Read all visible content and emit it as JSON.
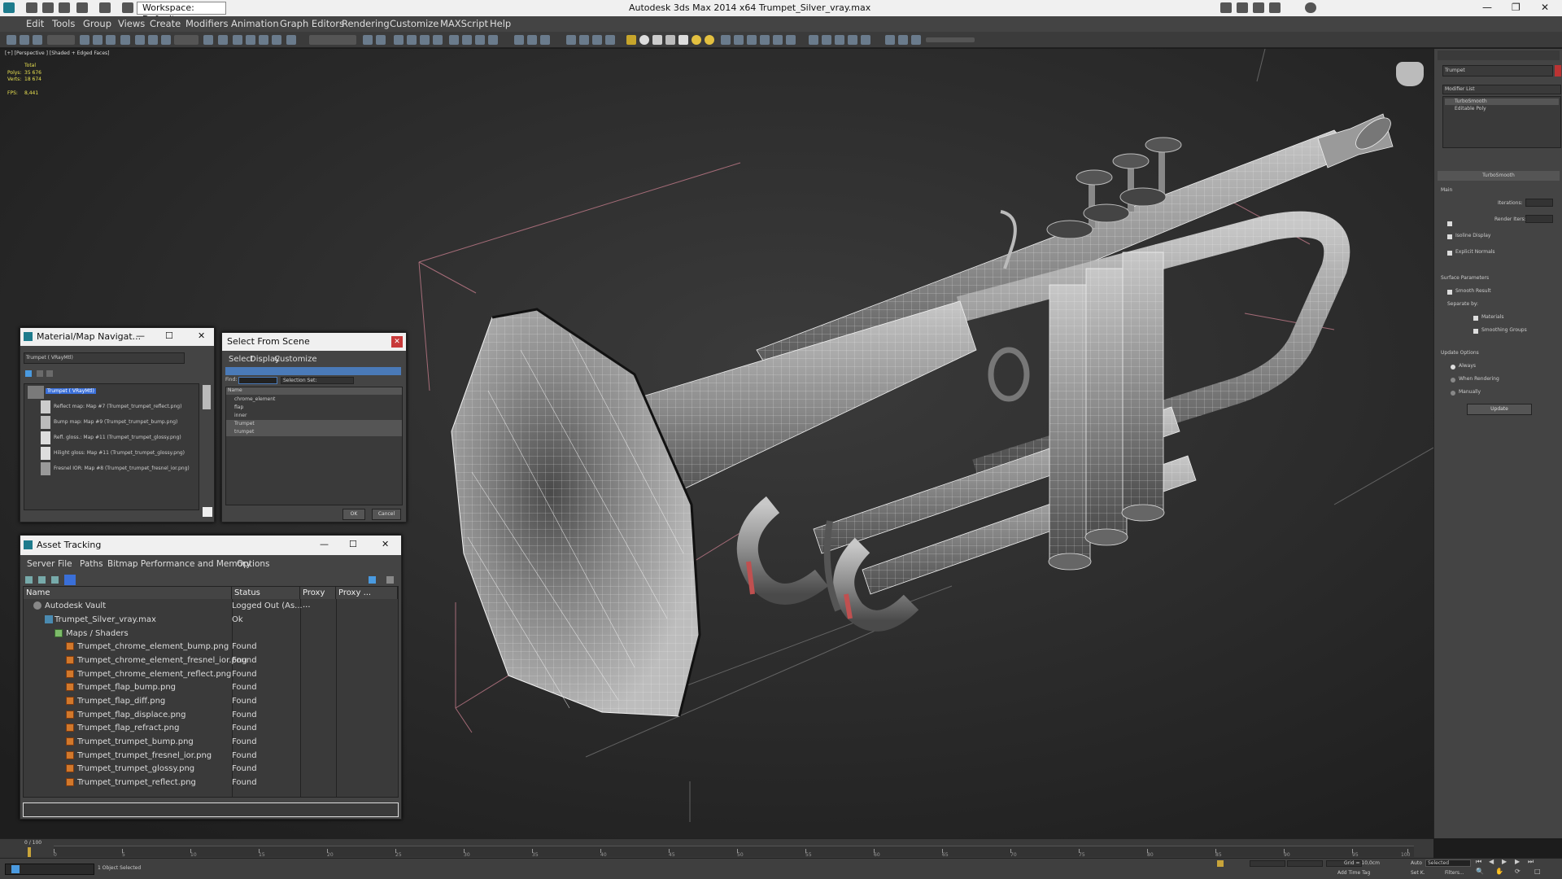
{
  "app": {
    "title": "Autodesk 3ds Max  2014 x64    Trumpet_Silver_vray.max",
    "workspace": "Workspace: Default"
  },
  "menu": [
    "Edit",
    "Tools",
    "Group",
    "Views",
    "Create",
    "Modifiers",
    "Animation",
    "Graph Editors",
    "Rendering",
    "Customize",
    "MAXScript",
    "Help"
  ],
  "viewport": {
    "label": "[+] [Perspective ] [Shaded + Edged Faces]",
    "stats": {
      "total_label": "Total",
      "polys_label": "Polys:",
      "polys": "35 676",
      "verts_label": "Verts:",
      "verts": "18 674",
      "fps_label": "FPS:",
      "fps": "8,441"
    }
  },
  "material_nav": {
    "title": "Material/Map Navigat...",
    "field": "Trumpet ( VRayMtl)",
    "items": [
      "Trumpet ( VRayMtl)",
      "Reflect map: Map #7 (Trumpet_trumpet_reflect.png)",
      "Bump map: Map #9 (Trumpet_trumpet_bump.png)",
      "Refl. gloss.: Map #11 (Trumpet_trumpet_glossy.png)",
      "Hilight gloss: Map #11 (Trumpet_trumpet_glossy.png)",
      "Fresnel IOR: Map #8 (Trumpet_trumpet_fresnel_ior.png)"
    ]
  },
  "select_scene": {
    "title": "Select From Scene",
    "menu": [
      "Select",
      "Display",
      "Customize"
    ],
    "find_label": "Find:",
    "selection_set": "Selection Set:",
    "col_name": "Name",
    "items": [
      "chrome_element",
      "flap",
      "inner",
      "Trumpet",
      "trumpet"
    ],
    "ok": "OK",
    "cancel": "Cancel"
  },
  "asset_tracking": {
    "title": "Asset Tracking",
    "menu": [
      "Server",
      "File",
      "Paths",
      "Bitmap Performance and Memory",
      "Options"
    ],
    "columns": [
      "Name",
      "Status",
      "Proxy ...",
      "Proxy ..."
    ],
    "rows": [
      {
        "name": "Autodesk Vault",
        "status": "Logged Out (As..."
      },
      {
        "name": "Trumpet_Silver_vray.max",
        "status": "Ok"
      },
      {
        "name": "Maps / Shaders",
        "status": ""
      },
      {
        "name": "Trumpet_chrome_element_bump.png",
        "status": "Found"
      },
      {
        "name": "Trumpet_chrome_element_fresnel_ior.png",
        "status": "Found"
      },
      {
        "name": "Trumpet_chrome_element_reflect.png",
        "status": "Found"
      },
      {
        "name": "Trumpet_flap_bump.png",
        "status": "Found"
      },
      {
        "name": "Trumpet_flap_diff.png",
        "status": "Found"
      },
      {
        "name": "Trumpet_flap_displace.png",
        "status": "Found"
      },
      {
        "name": "Trumpet_flap_refract.png",
        "status": "Found"
      },
      {
        "name": "Trumpet_trumpet_bump.png",
        "status": "Found"
      },
      {
        "name": "Trumpet_trumpet_fresnel_ior.png",
        "status": "Found"
      },
      {
        "name": "Trumpet_trumpet_glossy.png",
        "status": "Found"
      },
      {
        "name": "Trumpet_trumpet_reflect.png",
        "status": "Found"
      }
    ]
  },
  "command_panel": {
    "object_name": "Trumpet",
    "modifier_list": "Modifier List",
    "stack": [
      "TurboSmooth",
      "Editable Poly"
    ],
    "rollout_title": "TurboSmooth",
    "main": "Main",
    "iterations": "Iterations:",
    "render_iters": "Render Iters:",
    "isoline": "Isoline Display",
    "explicit_normals": "Explicit Normals",
    "surface_params": "Surface Parameters",
    "smooth_result": "Smooth Result",
    "separate_by": "Separate by:",
    "materials": "Materials",
    "smoothing_groups": "Smoothing Groups",
    "update_options": "Update Options",
    "always": "Always",
    "when_rendering": "When Rendering",
    "manually": "Manually",
    "update": "Update"
  },
  "timeline": {
    "frame": "0 / 100",
    "ticks": [
      "0",
      "5",
      "10",
      "15",
      "20",
      "25",
      "30",
      "35",
      "40",
      "45",
      "50",
      "55",
      "60",
      "65",
      "70",
      "75",
      "80",
      "85",
      "90",
      "95",
      "100"
    ]
  },
  "status": {
    "objects": "1 Object Selected",
    "grid": "Grid = 10,0cm",
    "add_time_tag": "Add Time Tag",
    "auto": "Auto",
    "selected": "Selected",
    "set_k": "Set K.",
    "filters": "Filters..."
  },
  "colors": {
    "viewport_bg": "#2a2a2a",
    "panel_bg": "#444444",
    "highlight": "#3a6fd8",
    "found_icon": "#d2782b"
  }
}
